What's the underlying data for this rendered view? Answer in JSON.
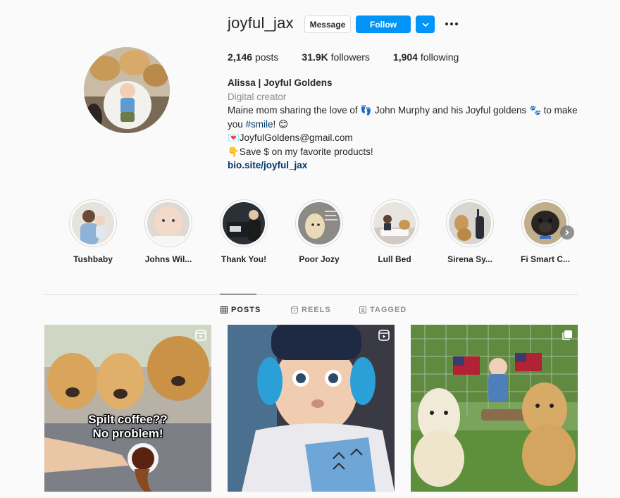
{
  "profile": {
    "username": "joyful_jax",
    "message_label": "Message",
    "follow_label": "Follow",
    "stats": {
      "posts_count": "2,146",
      "posts_label": "posts",
      "followers_count": "31.9K",
      "followers_label": "followers",
      "following_count": "1,904",
      "following_label": "following"
    },
    "bio": {
      "name": "Alissa | Joyful Goldens",
      "category": "Digital creator",
      "line1_a": "Maine mom sharing the love of 👣 John Murphy and his Joyful goldens 🐾 to make",
      "line2_a": "you ",
      "hashtag": "#smile",
      "line2_b": "! 😊",
      "email_line": "💌JoyfulGoldens@gmail.com",
      "save_line": "👇Save $ on my favorite products!",
      "link": "bio.site/joyful_jax"
    }
  },
  "highlights": [
    {
      "label": "Tushbaby"
    },
    {
      "label": "Johns Wil..."
    },
    {
      "label": "Thank You!"
    },
    {
      "label": "Poor Jozy"
    },
    {
      "label": "Lull Bed"
    },
    {
      "label": "Sirena Sy..."
    },
    {
      "label": "Fi Smart C..."
    }
  ],
  "tabs": {
    "posts": "POSTS",
    "reels": "REELS",
    "tagged": "TAGGED"
  },
  "posts": [
    {
      "overlay_line1": "Spilt coffee??",
      "overlay_line2": "No problem!",
      "badge": "reel-icon"
    },
    {
      "badge": "reel-icon"
    },
    {
      "badge": "carousel-icon"
    }
  ],
  "colors": {
    "accent": "#0095f6",
    "link": "#00376b",
    "muted": "#8e8e8e",
    "text": "#262626",
    "background": "#fafafa"
  }
}
